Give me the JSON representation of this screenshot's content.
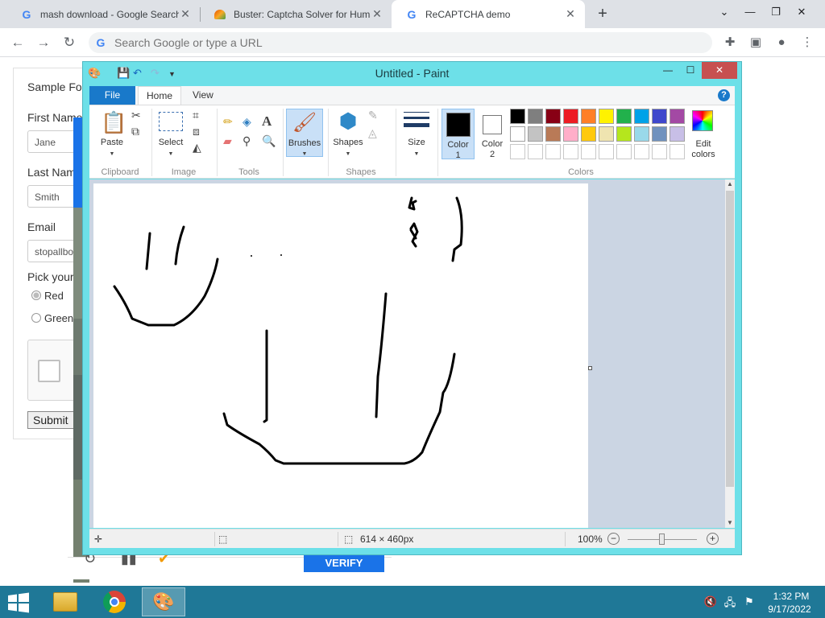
{
  "browser": {
    "tabs": [
      {
        "title": "mash download - Google Search",
        "icon": "google-g-icon"
      },
      {
        "title": "Buster: Captcha Solver for Humans",
        "icon": "buster-logo-icon"
      },
      {
        "title": "ReCAPTCHA demo",
        "icon": "google-g-icon"
      }
    ],
    "new_tab": "+",
    "omnibox_placeholder": "Search Google or type a URL"
  },
  "form": {
    "title": "Sample Form",
    "first_name_label": "First Name",
    "first_name_value": "Jane",
    "last_name_label": "Last Name",
    "last_name_value": "Smith",
    "email_label": "Email",
    "email_value": "stopallbots@gmail.com",
    "pick_label": "Pick your favorite color",
    "radio_red": "Red",
    "radio_green": "Green",
    "submit": "Submit",
    "verify": "VERIFY"
  },
  "paint": {
    "title": "Untitled - Paint",
    "tabs": {
      "file": "File",
      "home": "Home",
      "view": "View"
    },
    "help": "?",
    "groups": {
      "clipboard": "Clipboard",
      "image": "Image",
      "tools": "Tools",
      "shapes": "Shapes",
      "colors": "Colors"
    },
    "buttons": {
      "paste": "Paste",
      "select": "Select",
      "brushes": "Brushes",
      "shapes": "Shapes",
      "size": "Size",
      "color1": "Color\n1",
      "color2": "Color\n2",
      "edit_colors": "Edit\ncolors"
    },
    "color1": "#000000",
    "color2": "#ffffff",
    "palette": [
      [
        "#000000",
        "#7f7f7f",
        "#880015",
        "#ed1c24",
        "#ff7f27",
        "#fff200",
        "#22b14c",
        "#00a2e8",
        "#3f48cc",
        "#a349a4"
      ],
      [
        "#ffffff",
        "#c3c3c3",
        "#b97a57",
        "#ffaec9",
        "#ffc90e",
        "#efe4b0",
        "#b5e61d",
        "#99d9ea",
        "#7092be",
        "#c8bfe7"
      ],
      [
        "#ffffff",
        "#ffffff",
        "#ffffff",
        "#ffffff",
        "#ffffff",
        "#ffffff",
        "#ffffff",
        "#ffffff",
        "#ffffff",
        "#ffffff"
      ]
    ],
    "status": {
      "canvas_size": "614 × 460px",
      "zoom": "100%",
      "zoom_level": 1.0
    }
  },
  "taskbar": {
    "time": "1:32 PM",
    "date": "9/17/2022"
  }
}
